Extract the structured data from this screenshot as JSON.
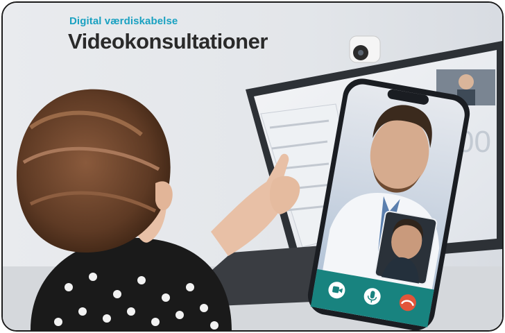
{
  "header": {
    "eyebrow": "Digital værdiskabelse",
    "title": "Videokonsultationer"
  },
  "illustration": {
    "icons": [
      "video-camera-icon",
      "microphone-icon",
      "hang-up-icon"
    ],
    "colors": {
      "brand_teal": "#1aa1c1",
      "call_bar": "#18837f",
      "hangup_red": "#e2553a"
    }
  }
}
